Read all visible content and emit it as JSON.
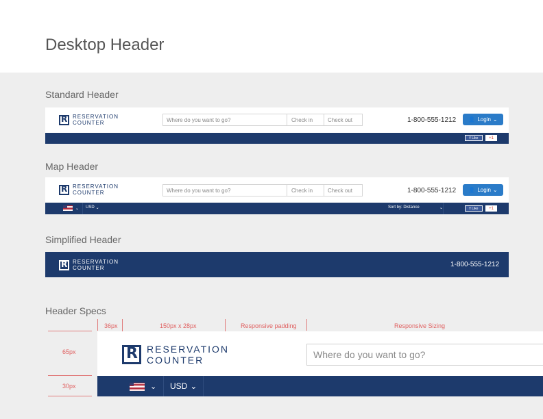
{
  "page_title": "Desktop Header",
  "brand": {
    "line1": "RESERVATION",
    "line2": "COUNTER",
    "mark": "R"
  },
  "sections": {
    "standard": {
      "label": "Standard Header",
      "search_placeholder": "Where do you want to go?",
      "checkin": "Check in",
      "checkout": "Check out",
      "phone": "1-800-555-1212",
      "login": "Login",
      "fb_like": "Like",
      "gplus": "+1"
    },
    "map": {
      "label": "Map Header",
      "search_placeholder": "Where do you want to go?",
      "checkin": "Check in",
      "checkout": "Check out",
      "phone": "1-800-555-1212",
      "login": "Login",
      "currency": "USD",
      "sort": "Sort by: Distance",
      "fb_like": "Like",
      "gplus": "+1"
    },
    "simplified": {
      "label": "Simplified Header",
      "phone": "1-800-555-1212"
    },
    "specs": {
      "label": "Header Specs",
      "dim_36": "36px",
      "dim_logo": "150px x 28px",
      "dim_padding": "Responsive padding",
      "dim_sizing": "Responsive Sizing",
      "dim_65": "65px",
      "dim_30": "30px",
      "search_placeholder": "Where do you want to go?",
      "currency": "USD"
    }
  },
  "colors": {
    "navy": "#1d3a6c",
    "button_blue": "#2a7bc8",
    "spec_red": "#e06060",
    "background_gray": "#eeeeee"
  }
}
